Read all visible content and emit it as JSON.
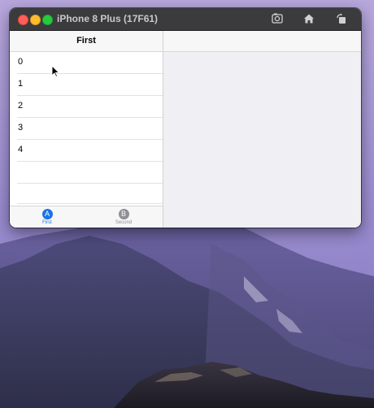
{
  "window": {
    "title": "iPhone 8 Plus (17F61)"
  },
  "toolbar_icons": [
    "screenshot-icon",
    "home-icon",
    "rotate-icon"
  ],
  "master": {
    "nav_title": "First",
    "rows": [
      "0",
      "1",
      "2",
      "3",
      "4",
      "",
      ""
    ]
  },
  "tabbar": {
    "tabs": [
      {
        "badge": "A",
        "label": "First",
        "selected": true
      },
      {
        "badge": "B",
        "label": "Second",
        "selected": false
      }
    ]
  },
  "colors": {
    "tint": "#1a73e8",
    "inactive": "#8e8e93",
    "titlebar": "#3b3b3d"
  }
}
